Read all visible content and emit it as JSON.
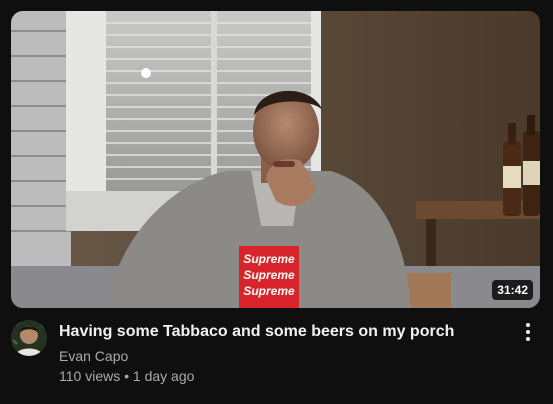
{
  "video": {
    "duration": "31:42",
    "title": "Having some Tabbaco and some beers on my porch",
    "channel": "Evan Capo",
    "views": "110 views",
    "separator": "•",
    "age": "1 day ago",
    "shirt_text": "Supreme"
  },
  "icons": {
    "more": "more-vert-icon"
  },
  "colors": {
    "background": "#0f0f0f",
    "title": "#f1f1f1",
    "secondary": "#aaaaaa"
  }
}
